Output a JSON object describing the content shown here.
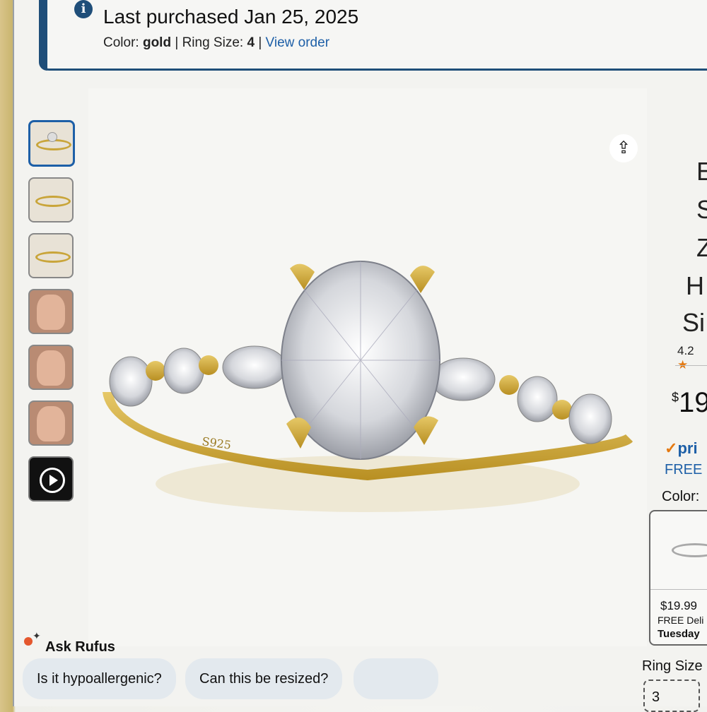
{
  "banner": {
    "title": "Last purchased Jan 25, 2025",
    "color_label": "Color:",
    "color_value": "gold",
    "sep1": "|",
    "size_label": "Ring Size:",
    "size_value": "4",
    "sep2": "|",
    "view_order": "View order",
    "info_icon": "i"
  },
  "thumbnails": [
    {
      "kind": "ring-thumbnail",
      "selected": true
    },
    {
      "kind": "ring-box-thumbnail",
      "selected": false
    },
    {
      "kind": "ring-side-thumbnail",
      "selected": false
    },
    {
      "kind": "hand-thumbnail",
      "selected": false
    },
    {
      "kind": "model-thumbnail",
      "selected": false
    },
    {
      "kind": "model-hand-thumbnail",
      "selected": false
    },
    {
      "kind": "video-thumbnail",
      "selected": false
    }
  ],
  "main_image": {
    "engraving": "S925",
    "share_icon": "share-icon"
  },
  "rufus": {
    "title": "Ask Rufus",
    "chips": [
      "Is it hypoallergenic?",
      "Can this be resized?",
      ""
    ]
  },
  "right": {
    "title_letters": [
      "E",
      "S",
      "Z",
      "H",
      "Si"
    ],
    "rating": "4.2",
    "price_symbol": "$",
    "price": "19",
    "prime": "pri",
    "free": "FREE",
    "color_label": "Color:",
    "card_price": "$19.99",
    "card_delivery": "FREE Deli",
    "card_day": "Tuesday",
    "ring_size_label": "Ring Size",
    "ring_size_value": "3"
  },
  "colors": {
    "accent_blue": "#1f4e79",
    "link": "#1d5fa7",
    "gold": "#c9a53a"
  }
}
